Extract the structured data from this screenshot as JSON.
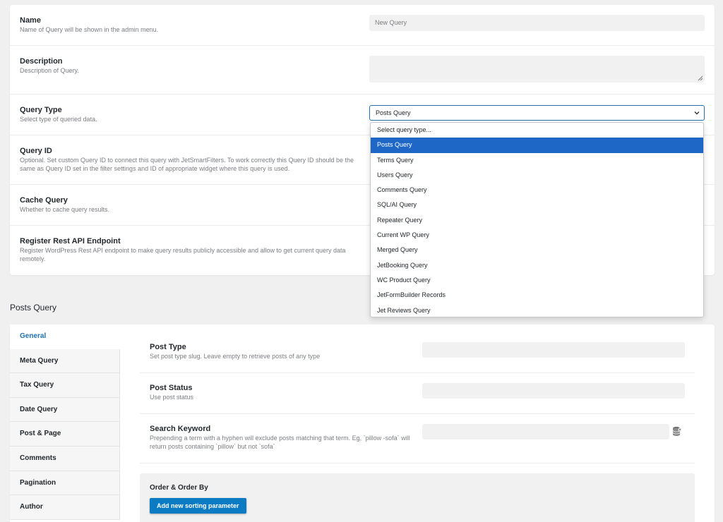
{
  "settings": {
    "name": {
      "title": "Name",
      "desc": "Name of Query will be shown in the admin menu.",
      "value": "New Query"
    },
    "description": {
      "title": "Description",
      "desc": "Description of Query.",
      "value": ""
    },
    "query_type": {
      "title": "Query Type",
      "desc": "Select type of queried data.",
      "value": "Posts Query"
    },
    "query_id": {
      "title": "Query ID",
      "desc": "Optional. Set custom Query ID to connect this query with JetSmartFilters. To work correctly this Query ID should be the same as Query ID set in the filter settings and ID of appropriate widget where this query is used."
    },
    "cache": {
      "title": "Cache Query",
      "desc": "Whether to cache query results."
    },
    "rest": {
      "title": "Register Rest API Endpoint",
      "desc": "Register WordPress Rest API endpoint to make query results publicly accessible and allow to get current query data remotely."
    }
  },
  "dropdown": {
    "options": [
      "Select query type...",
      "Posts Query",
      "Terms Query",
      "Users Query",
      "Comments Query",
      "SQL/AI Query",
      "Repeater Query",
      "Current WP Query",
      "Merged Query",
      "JetBooking Query",
      "WC Product Query",
      "JetFormBuilder Records",
      "Jet Reviews Query"
    ],
    "selected_index": 1
  },
  "section_title": "Posts Query",
  "tabs": [
    "General",
    "Meta Query",
    "Tax Query",
    "Date Query",
    "Post & Page",
    "Comments",
    "Pagination",
    "Author"
  ],
  "general": {
    "post_type": {
      "title": "Post Type",
      "desc": "Set post type slug. Leave empty to retrieve posts of any type"
    },
    "post_status": {
      "title": "Post Status",
      "desc": "Use post status"
    },
    "search": {
      "title": "Search Keyword",
      "desc": "Prepending a term with a hyphen will exclude posts matching that term. Eg, `pillow -sofa` will return posts containing `pillow` but not `sofa`"
    },
    "order": {
      "title": "Order & Order By",
      "button": "Add new sorting parameter"
    }
  },
  "icons": {
    "select_chevron": "chevron-down-icon",
    "dynamic_data": "database-icon"
  },
  "colors": {
    "accent": "#2271b1",
    "selected_option": "#1e67c7",
    "button": "#0b7bc4"
  }
}
